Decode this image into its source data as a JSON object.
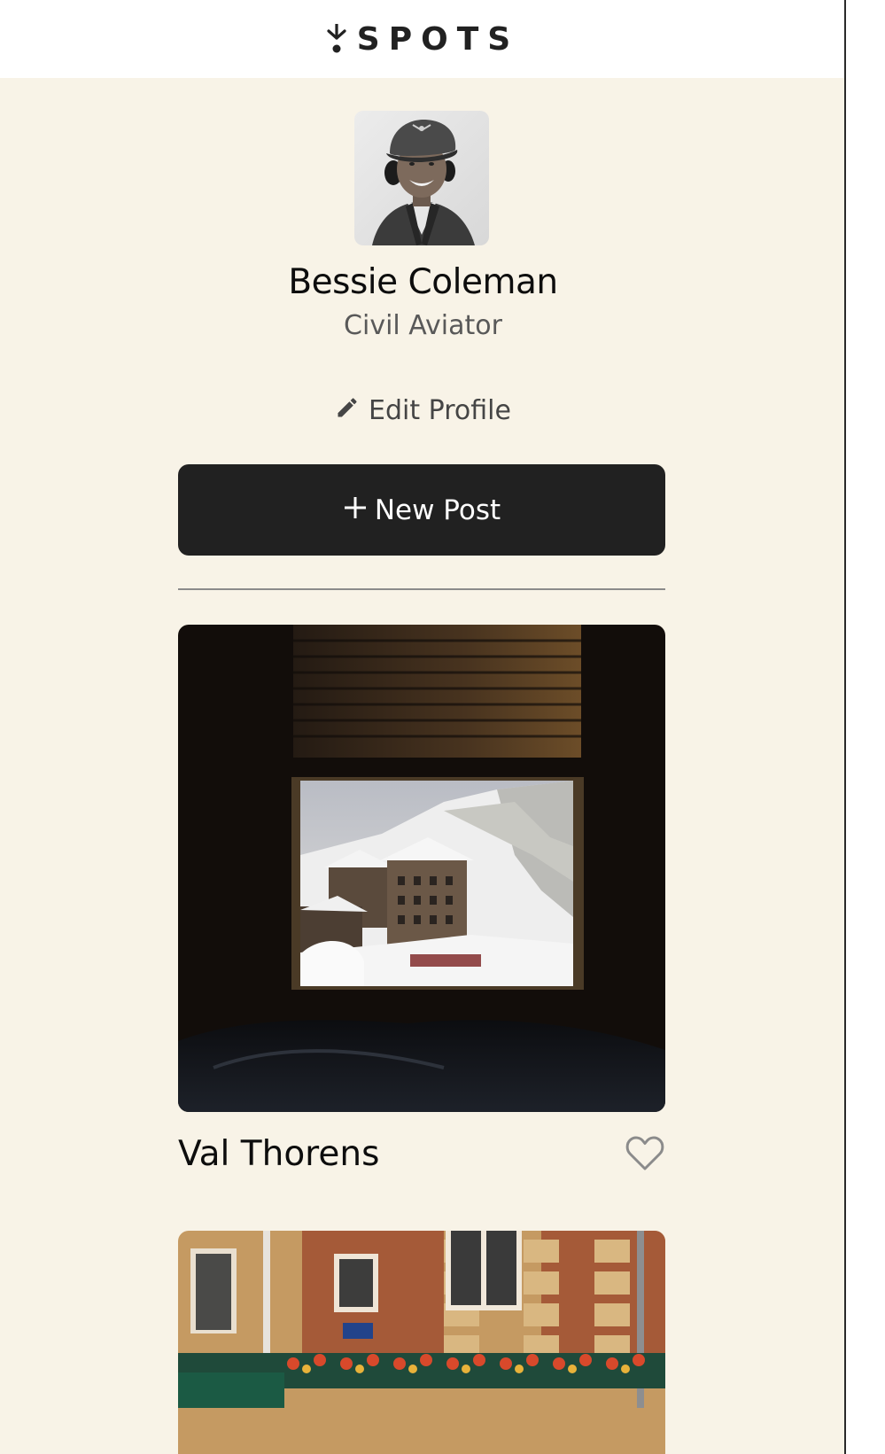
{
  "header": {
    "logo_text": "SPOTS"
  },
  "profile": {
    "name": "Bessie Coleman",
    "description": "Civil Aviator",
    "edit_label": "Edit Profile"
  },
  "actions": {
    "new_post_label": "New Post"
  },
  "cards": [
    {
      "title": "Val Thorens",
      "liked": false
    },
    {
      "title": "",
      "liked": false
    }
  ],
  "icons": {
    "logo": "spots-logo-icon",
    "edit": "pencil-icon",
    "new_post": "plus-icon",
    "like": "heart-icon"
  },
  "colors": {
    "page_background": "#f8f3e7",
    "header_background": "#ffffff",
    "button_background": "#212121",
    "text_primary": "#0d0d0d",
    "text_secondary": "#595959"
  }
}
